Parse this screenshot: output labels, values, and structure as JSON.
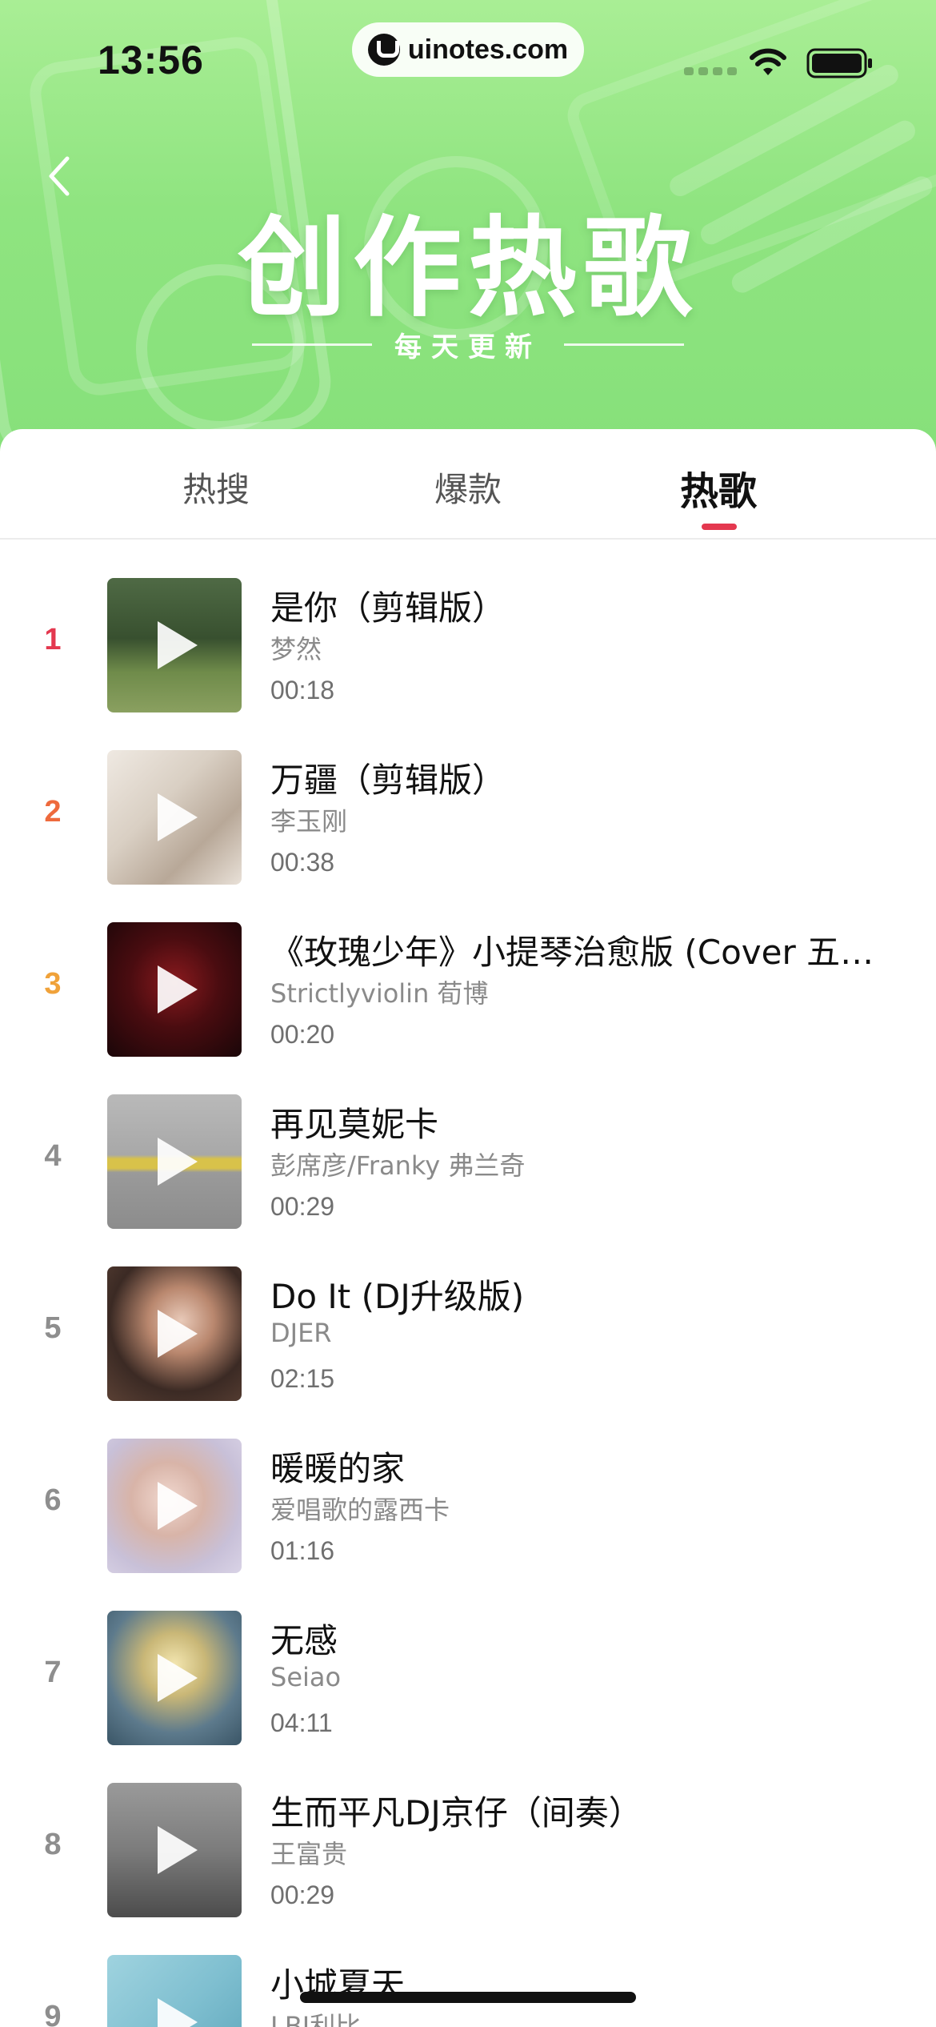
{
  "status_bar": {
    "time": "13:56",
    "url": "uinotes.com"
  },
  "banner": {
    "title": "创作热歌",
    "subtitle": "每天更新"
  },
  "tabs": [
    {
      "label": "热搜",
      "selected": false
    },
    {
      "label": "爆款",
      "selected": false
    },
    {
      "label": "热歌",
      "selected": true
    }
  ],
  "colors": {
    "accent": "#e4384f",
    "header_green": "#8fe480",
    "rank_1": "#e4384f",
    "rank_2": "#ee6a3d",
    "rank_3": "#f0a23a",
    "rank_default": "#8e8e8e"
  },
  "songs": [
    {
      "rank": "1",
      "title": "是你（剪辑版）",
      "artist": "梦然",
      "duration": "00:18"
    },
    {
      "rank": "2",
      "title": "万疆（剪辑版）",
      "artist": "李玉刚",
      "duration": "00:38"
    },
    {
      "rank": "3",
      "title": "《玫瑰少年》小提琴治愈版 (Cover 五…",
      "artist": "Strictlyviolin 荀博",
      "duration": "00:20"
    },
    {
      "rank": "4",
      "title": "再见莫妮卡",
      "artist": "彭席彦/Franky 弗兰奇",
      "duration": "00:29"
    },
    {
      "rank": "5",
      "title": "Do It (DJ升级版)",
      "artist": "DJER",
      "duration": "02:15"
    },
    {
      "rank": "6",
      "title": "暖暖的家",
      "artist": "爱唱歌的露西卡",
      "duration": "01:16"
    },
    {
      "rank": "7",
      "title": "无感",
      "artist": "Seiao",
      "duration": "04:11"
    },
    {
      "rank": "8",
      "title": "生而平凡DJ京仔（间奏）",
      "artist": "王富贵",
      "duration": "00:29"
    },
    {
      "rank": "9",
      "title": "小城夏天",
      "artist": "LBI利比",
      "duration": ""
    }
  ]
}
